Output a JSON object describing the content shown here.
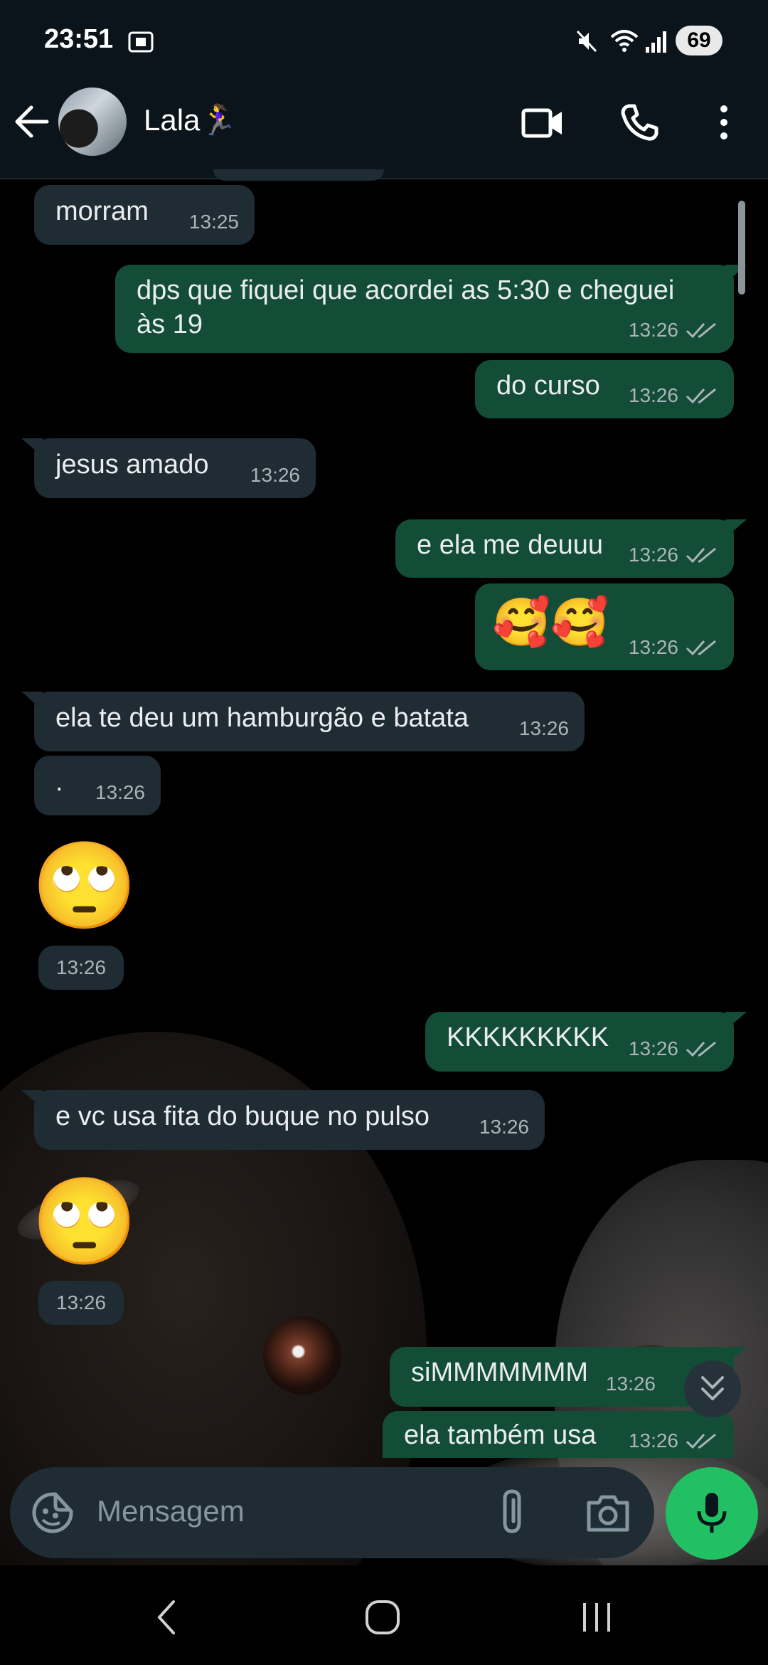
{
  "status_bar": {
    "time": "23:51",
    "battery": "69"
  },
  "header": {
    "contact_name": "Lala🏃‍♀️"
  },
  "messages": [
    {
      "dir": "in",
      "text": "morram",
      "time": "13:25"
    },
    {
      "dir": "out",
      "text_line1": "dps que fiquei que acordei as 5:30 e cheguei",
      "text_line2": "às 19",
      "time": "13:26"
    },
    {
      "dir": "out",
      "text": "do curso",
      "time": "13:26"
    },
    {
      "dir": "in",
      "text": "jesus amado",
      "time": "13:26"
    },
    {
      "dir": "out",
      "text": "e ela me deuuu",
      "time": "13:26"
    },
    {
      "dir": "out",
      "text": "🥰🥰",
      "time": "13:26"
    },
    {
      "dir": "in",
      "text": "ela te deu um hamburgão e batata",
      "time": "13:26"
    },
    {
      "dir": "in",
      "text": ".",
      "time": "13:26"
    },
    {
      "dir": "in",
      "emoji": "🙄",
      "time": "13:26"
    },
    {
      "dir": "out",
      "text": "KKKKKKKKK",
      "time": "13:26"
    },
    {
      "dir": "in",
      "text": "e vc usa fita do buque no pulso",
      "time": "13:26"
    },
    {
      "dir": "in",
      "emoji": "🙄",
      "time": "13:26"
    },
    {
      "dir": "out",
      "text": "siMMMMMMM",
      "time": "13:26"
    },
    {
      "dir": "out",
      "text": "ela também usa",
      "time": "13:26"
    }
  ],
  "composer": {
    "placeholder": "Mensagem"
  },
  "icons": [
    "back-arrow-icon",
    "video-call-icon",
    "phone-icon",
    "more-vert-icon",
    "sticker-icon",
    "attach-icon",
    "camera-icon",
    "mic-icon",
    "double-check-icon",
    "scroll-down-icon",
    "nav-back-icon",
    "nav-home-icon",
    "nav-recents-icon"
  ],
  "colors": {
    "incoming": "#202c33",
    "outgoing": "#144d37",
    "accent": "#21c063",
    "header": "#0b141a"
  }
}
